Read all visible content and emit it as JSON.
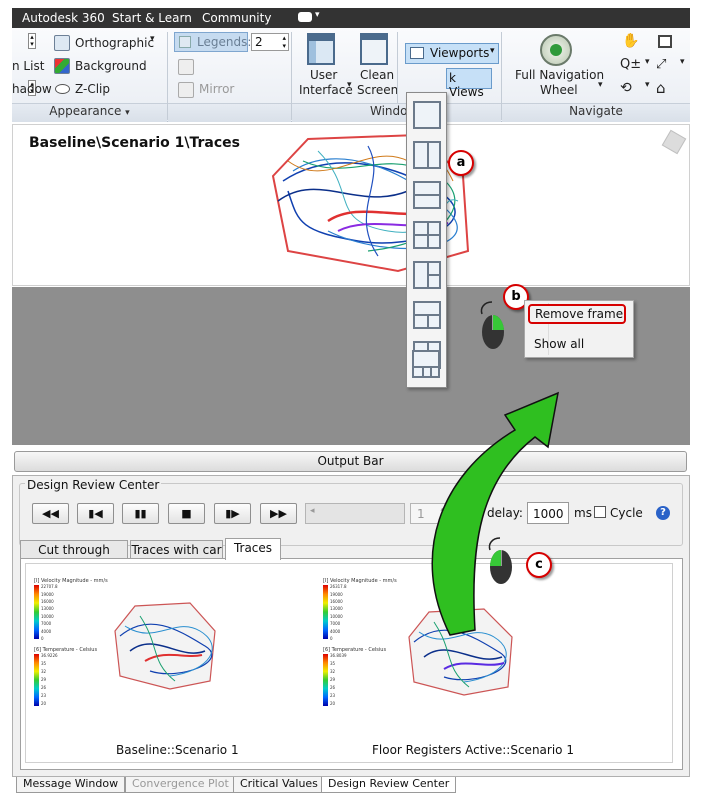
{
  "topbar": {
    "items": [
      "Autodesk 360",
      "Start & Learn",
      "Community"
    ]
  },
  "ribbon": {
    "orthographic": "Orthographic",
    "legends_label": "Legends:",
    "legends_value": "2",
    "n_list": "n List",
    "background": "Background",
    "hadow": "hadow",
    "zclip": "Z-Clip",
    "mirror": "Mirror",
    "user_interface": [
      "User",
      "Interface"
    ],
    "clean_screen": [
      "Clean",
      "Screen"
    ],
    "viewports": "Viewports",
    "k_views": "k Views",
    "full_nav": [
      "Full Navigation",
      "Wheel"
    ],
    "panel_appearance": "Appearance",
    "panel_window": "Windo",
    "panel_navigate": "Navigate"
  },
  "viewport": {
    "title": "Baseline\\Scenario 1\\Traces"
  },
  "context_menu": {
    "items": [
      "Remove frame",
      "Show all"
    ]
  },
  "callouts": [
    "a",
    "b",
    "c"
  ],
  "output_bar": "Output Bar",
  "drc": {
    "title": "Design Review Center",
    "frame_value": "1",
    "frame_delay_label": "F",
    "delay_label": "delay:",
    "delay_value": "1000",
    "delay_unit": "ms",
    "cycle_label": "Cycle",
    "tabs": [
      "Cut through seats",
      "Traces with car",
      "Traces"
    ],
    "thumb_left_caption": "Baseline::Scenario 1",
    "thumb_right_caption": "Floor Registers Active::Scenario 1",
    "legend_vel_title": "[I] Velocity Magnitude - mm/s",
    "legend_temp_title": "[6] Temperature - Celsius",
    "legend_vel_left": [
      "22707.8",
      "19000",
      "16000",
      "13000",
      "10000",
      "7000",
      "4000",
      "0"
    ],
    "legend_vel_right": [
      "26317.8",
      "19000",
      "16000",
      "13000",
      "10000",
      "7000",
      "4000",
      "0"
    ],
    "legend_temp_left": [
      "36.9226",
      "35",
      "32",
      "29",
      "26",
      "23",
      "20"
    ],
    "legend_temp_right": [
      "36.8039",
      "35",
      "32",
      "29",
      "26",
      "23",
      "20"
    ]
  },
  "bottom_tabs": [
    "Message Window",
    "Convergence Plot",
    "Critical Values",
    "Design Review Center"
  ],
  "colors": {
    "callout_border": "#d60000",
    "arrow_green": "#2fbf20",
    "active_highlight": "#c6e0f7"
  }
}
